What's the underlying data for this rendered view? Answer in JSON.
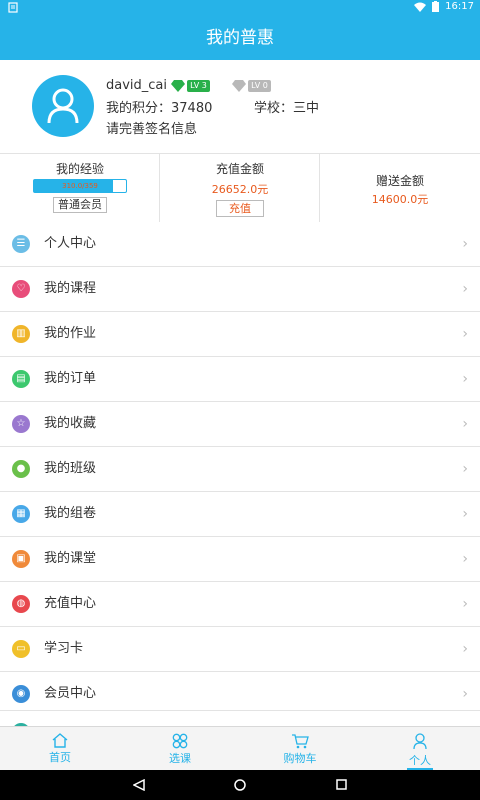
{
  "status": {
    "time": "16:17"
  },
  "header": {
    "title": "我的普惠"
  },
  "profile": {
    "username": "david_cai",
    "level_badge": "LV 3",
    "level_badge2": "LV 0",
    "points": "我的积分：37480",
    "school": "学校：三中",
    "hint": "请完善签名信息"
  },
  "stats": {
    "experience": {
      "title": "我的经验",
      "value_text": "310.0/359",
      "fill_fraction": 0.86,
      "member_label": "普通会员"
    },
    "recharge": {
      "title": "充值金额",
      "amount": "26652.0元",
      "button_label": "充值"
    },
    "gift": {
      "title": "赠送金额",
      "amount": "14600.0元"
    }
  },
  "menu": [
    {
      "label": "个人中心",
      "icon": "person-card-icon",
      "color": "#6bbde6",
      "glyph": "☰"
    },
    {
      "label": "我的课程",
      "icon": "heart-icon",
      "color": "#e84d7a",
      "glyph": "♡"
    },
    {
      "label": "我的作业",
      "icon": "book-icon",
      "color": "#f0b52a",
      "glyph": "▥"
    },
    {
      "label": "我的订单",
      "icon": "order-icon",
      "color": "#3cc86e",
      "glyph": "▤"
    },
    {
      "label": "我的收藏",
      "icon": "star-icon",
      "color": "#9a78cf",
      "glyph": "☆"
    },
    {
      "label": "我的班级",
      "icon": "group-icon",
      "color": "#6ac04a",
      "glyph": "●"
    },
    {
      "label": "我的组卷",
      "icon": "chart-icon",
      "color": "#48a8e8",
      "glyph": "▦"
    },
    {
      "label": "我的课堂",
      "icon": "image-icon",
      "color": "#f08a3a",
      "glyph": "▣"
    },
    {
      "label": "充值中心",
      "icon": "piggy-icon",
      "color": "#e8484e",
      "glyph": "◍"
    },
    {
      "label": "学习卡",
      "icon": "card-icon",
      "color": "#f0c02a",
      "glyph": "▭"
    },
    {
      "label": "会员中心",
      "icon": "member-icon",
      "color": "#3a8ed8",
      "glyph": "◉"
    }
  ],
  "tabs": [
    {
      "label": "首页",
      "icon": "home-icon"
    },
    {
      "label": "选课",
      "icon": "select-course-icon"
    },
    {
      "label": "购物车",
      "icon": "cart-icon"
    },
    {
      "label": "个人",
      "icon": "person-icon"
    }
  ],
  "colors": {
    "accent": "#26b3e8",
    "orange": "#e85a1e"
  }
}
